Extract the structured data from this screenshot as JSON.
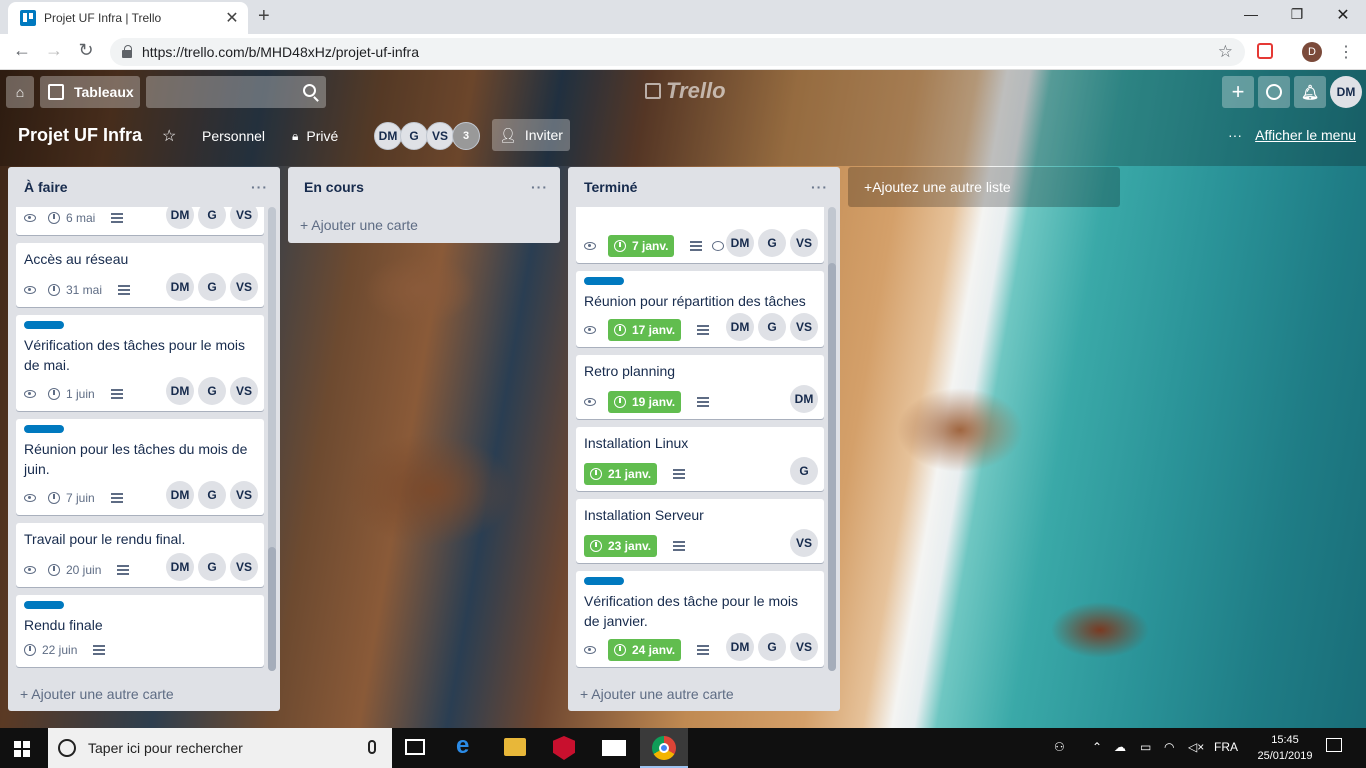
{
  "browser": {
    "tab_title": "Projet UF Infra | Trello",
    "url": "https://trello.com/b/MHD48xHz/projet-uf-infra",
    "profile_initial": "D"
  },
  "header": {
    "boards_label": "Tableaux",
    "logo_text": "Trello",
    "user_initials": "DM"
  },
  "board": {
    "title": "Projet UF Infra",
    "team_label": "Personnel",
    "visibility_label": "Privé",
    "members": [
      "DM",
      "G",
      "VS"
    ],
    "members_more": "3",
    "invite_label": "Inviter",
    "show_menu_label": "Afficher le menu"
  },
  "lists": [
    {
      "title": "À faire",
      "add_card_label": "Ajouter une autre carte",
      "cards": [
        {
          "title": "",
          "label": false,
          "due": "6 mai",
          "due_done": false,
          "watch": true,
          "desc": true,
          "comments": "",
          "members": [
            "DM",
            "G",
            "VS"
          ]
        },
        {
          "title": "Accès au réseau",
          "label": false,
          "due": "31 mai",
          "due_done": false,
          "watch": true,
          "desc": true,
          "comments": "",
          "members": [
            "DM",
            "G",
            "VS"
          ]
        },
        {
          "title": "Vérification des tâches pour le mois de mai.",
          "label": true,
          "due": "1 juin",
          "due_done": false,
          "watch": true,
          "desc": true,
          "comments": "",
          "members": [
            "DM",
            "G",
            "VS"
          ]
        },
        {
          "title": "Réunion pour les tâches du mois de juin.",
          "label": true,
          "due": "7 juin",
          "due_done": false,
          "watch": true,
          "desc": true,
          "comments": "",
          "members": [
            "DM",
            "G",
            "VS"
          ]
        },
        {
          "title": "Travail pour le rendu final.",
          "label": false,
          "due": "20 juin",
          "due_done": false,
          "watch": true,
          "desc": true,
          "comments": "",
          "members": [
            "DM",
            "G",
            "VS"
          ]
        },
        {
          "title": "Rendu finale",
          "label": true,
          "due": "22 juin",
          "due_done": false,
          "watch": false,
          "desc": true,
          "comments": "",
          "members": []
        }
      ]
    },
    {
      "title": "En cours",
      "add_card_label": "Ajouter une carte",
      "cards": []
    },
    {
      "title": "Terminé",
      "add_card_label": "Ajouter une autre carte",
      "cards": [
        {
          "title": "",
          "label": false,
          "due": "7 janv.",
          "due_done": true,
          "watch": true,
          "desc": true,
          "comments": "1",
          "members": [
            "DM",
            "G",
            "VS"
          ]
        },
        {
          "title": "Réunion pour répartition des tâches",
          "label": true,
          "due": "17 janv.",
          "due_done": true,
          "watch": true,
          "desc": true,
          "comments": "",
          "members": [
            "DM",
            "G",
            "VS"
          ]
        },
        {
          "title": "Retro planning",
          "label": false,
          "due": "19 janv.",
          "due_done": true,
          "watch": true,
          "desc": true,
          "comments": "",
          "members": [
            "DM"
          ]
        },
        {
          "title": "Installation Linux",
          "label": false,
          "due": "21 janv.",
          "due_done": true,
          "watch": false,
          "desc": true,
          "comments": "",
          "members": [
            "G"
          ]
        },
        {
          "title": "Installation Serveur",
          "label": false,
          "due": "23 janv.",
          "due_done": true,
          "watch": false,
          "desc": true,
          "comments": "",
          "members": [
            "VS"
          ]
        },
        {
          "title": "Vérification des tâche pour le mois de janvier.",
          "label": true,
          "due": "24 janv.",
          "due_done": true,
          "watch": true,
          "desc": true,
          "comments": "",
          "members": [
            "DM",
            "G",
            "VS"
          ]
        }
      ]
    }
  ],
  "add_list_label": "Ajoutez une autre liste",
  "taskbar": {
    "search_placeholder": "Taper ici pour rechercher",
    "language": "FRA",
    "time": "15:45",
    "date": "25/01/2019"
  },
  "colors": {
    "label_blue": "#0079bf",
    "due_green": "#61bd4f",
    "list_bg": "#dfe1e6"
  }
}
